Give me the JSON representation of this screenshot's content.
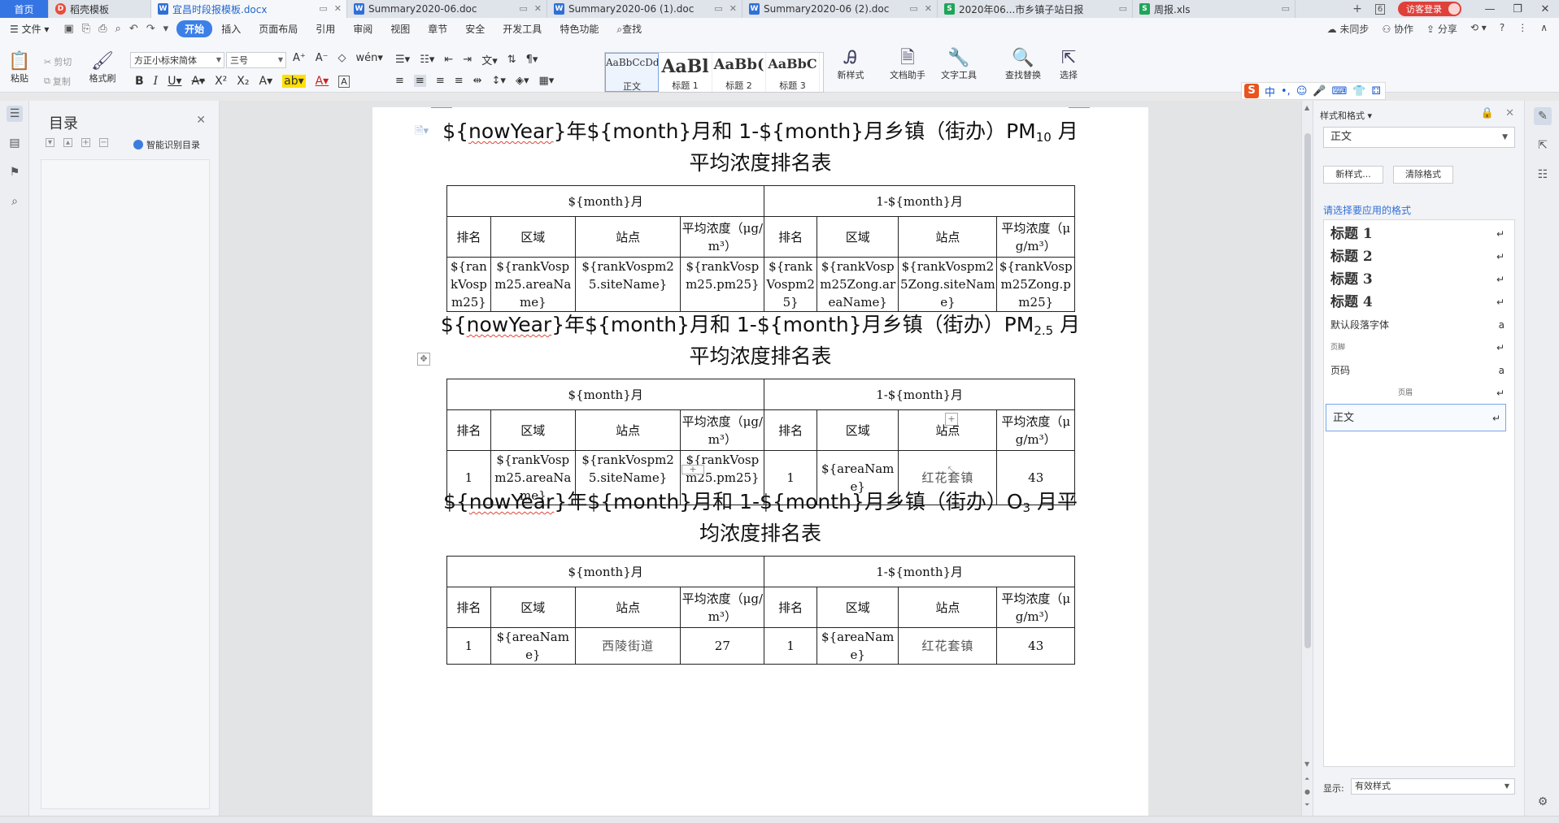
{
  "tabs": [
    {
      "label": "首页",
      "kind": "home"
    },
    {
      "label": "稻壳模板",
      "kind": "docer"
    },
    {
      "label": "宜昌时段报模板.docx",
      "kind": "word",
      "active": true
    },
    {
      "label": "Summary2020-06.doc",
      "kind": "word"
    },
    {
      "label": "Summary2020-06 (1).doc",
      "kind": "word"
    },
    {
      "label": "Summary2020-06 (2).doc",
      "kind": "word"
    },
    {
      "label": "2020年06...市乡镇子站日报",
      "kind": "sheet"
    },
    {
      "label": "周报.xls",
      "kind": "sheet"
    }
  ],
  "tab_counter": "6",
  "login_label": "访客登录",
  "menu": {
    "file": "文件",
    "items": [
      "开始",
      "插入",
      "页面布局",
      "引用",
      "审阅",
      "视图",
      "章节",
      "安全",
      "开发工具",
      "特色功能"
    ],
    "active": "开始",
    "search": "查找",
    "right": [
      "未同步",
      "协作",
      "分享"
    ]
  },
  "ribbon": {
    "paste": "粘贴",
    "cut": "剪切",
    "copy": "复制",
    "format_painter": "格式刷",
    "font_name": "方正小标宋简体",
    "font_size": "三号",
    "styles": [
      {
        "preview": "AaBbCcDd",
        "name": "正文"
      },
      {
        "preview": "AaBl",
        "name": "标题 1"
      },
      {
        "preview": "AaBb(",
        "name": "标题 2"
      },
      {
        "preview": "AaBbC",
        "name": "标题 3"
      }
    ],
    "new_style": "新样式",
    "doc_helper": "文档助手",
    "text_tools": "文字工具",
    "find_replace": "查找替换",
    "select": "选择"
  },
  "ime": {
    "lang": "中"
  },
  "toc": {
    "title": "目录",
    "smart": "智能识别目录"
  },
  "document": {
    "sections": [
      {
        "title_line1": [
          "${",
          "nowYear",
          "}年${month}月和 1-${month}月乡镇（街办）PM",
          "10",
          " 月"
        ],
        "title_line2": "平均浓度排名表",
        "group_left": "${month}月",
        "group_right": "1-${month}月",
        "headers": [
          "排名",
          "区域",
          "站点",
          "平均浓度（μg/m³）",
          "排名",
          "区域",
          "站点",
          "平均浓度（μg/m³）"
        ],
        "row": [
          "${rankVospm25}",
          "${rankVospm25.areaName}",
          "${rankVospm25.siteName}",
          "${rankVospm25.pm25}",
          "${rankVospm25}",
          "${rankVospm25Zong.areaName}",
          "${rankVospm25Zong.siteName}",
          "${rankVospm25Zong.pm25}"
        ]
      },
      {
        "title_line1": [
          "${",
          "nowYear",
          "}年${month}月和 1-${month}月乡镇（街办）PM",
          "2.5",
          " 月"
        ],
        "title_line2": "平均浓度排名表",
        "group_left": "${month}月",
        "group_right": "1-${month}月",
        "headers": [
          "排名",
          "区域",
          "站点",
          "平均浓度（μg/m³）",
          "排名",
          "区域",
          "站点",
          "平均浓度（μg/m³）"
        ],
        "row": [
          "1",
          "${rankVospm25.areaName}",
          "${rankVospm25.siteName}",
          "${rankVospm25.pm25}",
          "1",
          "${areaName}",
          "红花套镇",
          "43"
        ]
      },
      {
        "title_line1": [
          "${",
          "nowYear",
          "}年${month}月和 1-${month}月乡镇（街办）O",
          "3",
          " 月平"
        ],
        "title_line2": "均浓度排名表",
        "group_left": "${month}月",
        "group_right": "1-${month}月",
        "headers": [
          "排名",
          "区域",
          "站点",
          "平均浓度（μg/m³）",
          "排名",
          "区域",
          "站点",
          "平均浓度（μg/m³）"
        ],
        "row": [
          "1",
          "${areaName}",
          "西陵街道",
          "27",
          "1",
          "${areaName}",
          "红花套镇",
          "43"
        ]
      }
    ]
  },
  "styles_panel": {
    "header": "样式和格式",
    "current": "正文",
    "new_btn": "新样式...",
    "clear_btn": "清除格式",
    "choose_label": "请选择要应用的格式",
    "items": [
      {
        "name": "标题 1",
        "mark": "↵",
        "style": "h"
      },
      {
        "name": "标题 2",
        "mark": "↵",
        "style": "h"
      },
      {
        "name": "标题 3",
        "mark": "↵",
        "style": "h"
      },
      {
        "name": "标题 4",
        "mark": "↵",
        "style": "h"
      },
      {
        "name": "默认段落字体",
        "mark": "a",
        "style": "n"
      },
      {
        "name": "页脚",
        "mark": "↵",
        "style": "s"
      },
      {
        "name": "页码",
        "mark": "a",
        "style": "n"
      },
      {
        "name": "页眉",
        "mark": "↵",
        "style": "c"
      },
      {
        "name": "正文",
        "mark": "↵",
        "style": "sel"
      }
    ],
    "show_label": "显示:",
    "show_value": "有效样式"
  }
}
